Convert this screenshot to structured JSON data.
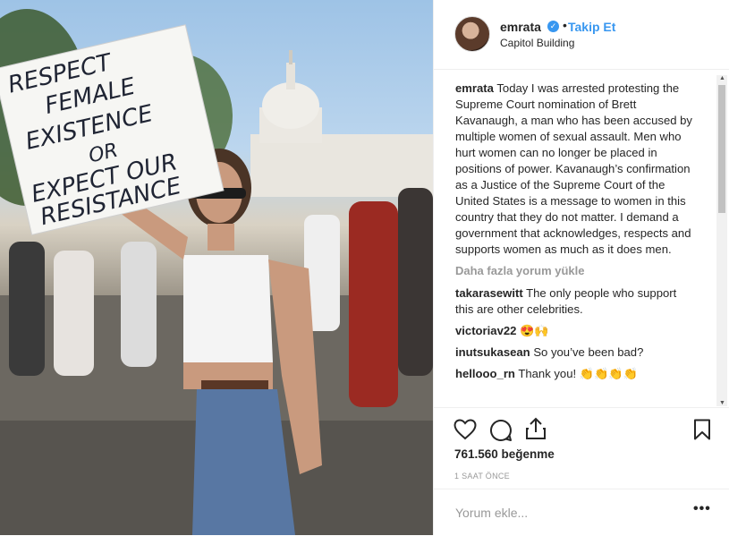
{
  "post": {
    "username": "emrata",
    "follow_label": "Takip Et",
    "separator": "•",
    "location": "Capitol Building",
    "caption_user": "emrata",
    "caption_text": "Today I was arrested protesting the Supreme Court nomination of Brett Kavanaugh, a man who has been accused by multiple women of sexual assault. Men who hurt women can no longer be placed in positions of power. Kavanaugh’s confirmation as a Justice of the Supreme Court of the United States is a message to women in this country that they do not matter. I demand a government that acknowledges, respects and supports women as much as it does men.",
    "load_more_label": "Daha fazla yorum yükle",
    "likes": "761.560 beğenme",
    "time_ago": "1 SAAT ÖNCE",
    "comment_placeholder": "Yorum ekle...",
    "more_options": "•••"
  },
  "photo": {
    "sign_lines": [
      "RESPECT",
      "FEMALE",
      "EXISTENCE",
      "OR",
      "EXPECT OUR",
      "RESISTANCE"
    ]
  },
  "comments": [
    {
      "user": "takarasewitt",
      "text": "The only people who support this are other celebrities."
    },
    {
      "user": "victoriav22",
      "text": "😍🙌"
    },
    {
      "user": "inutsukasean",
      "text": "So you’ve been bad?"
    },
    {
      "user": "hellooo_rn",
      "text": "Thank you! 👏👏👏👏"
    }
  ],
  "icons": {
    "verified": "verified-badge-icon",
    "like": "heart-icon",
    "comment": "comment-bubble-icon",
    "share": "share-icon",
    "save": "bookmark-icon"
  },
  "colors": {
    "link_blue": "#3897f0",
    "muted": "#999999",
    "text": "#262626"
  }
}
